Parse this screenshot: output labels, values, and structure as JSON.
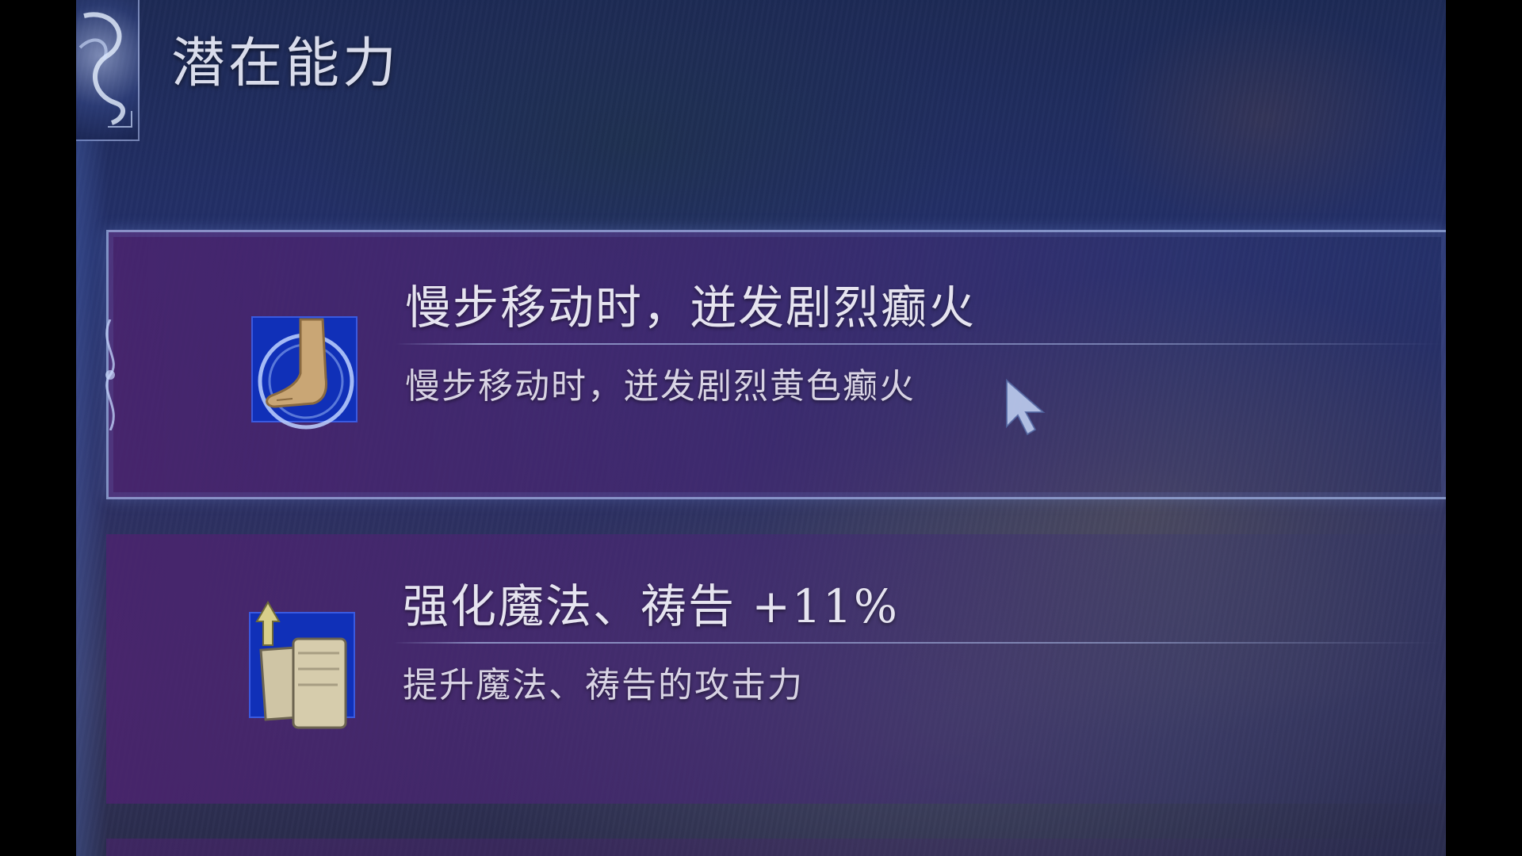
{
  "page": {
    "title": "潜在能力"
  },
  "abilities": [
    {
      "name": "慢步移动时，迸发剧烈癫火",
      "description": "慢步移动时，迸发剧烈黄色癫火",
      "icon": "foot-icon",
      "selected": true
    },
    {
      "name": "强化魔法、祷告 +11%",
      "description": "提升魔法、祷告的攻击力",
      "icon": "scroll-upgrade-icon",
      "selected": false
    }
  ],
  "colors": {
    "card_purple": "#4b236e",
    "icon_blue": "#1030b8",
    "text_light": "#e6e4f0",
    "frame_highlight": "#a0b4e6"
  }
}
